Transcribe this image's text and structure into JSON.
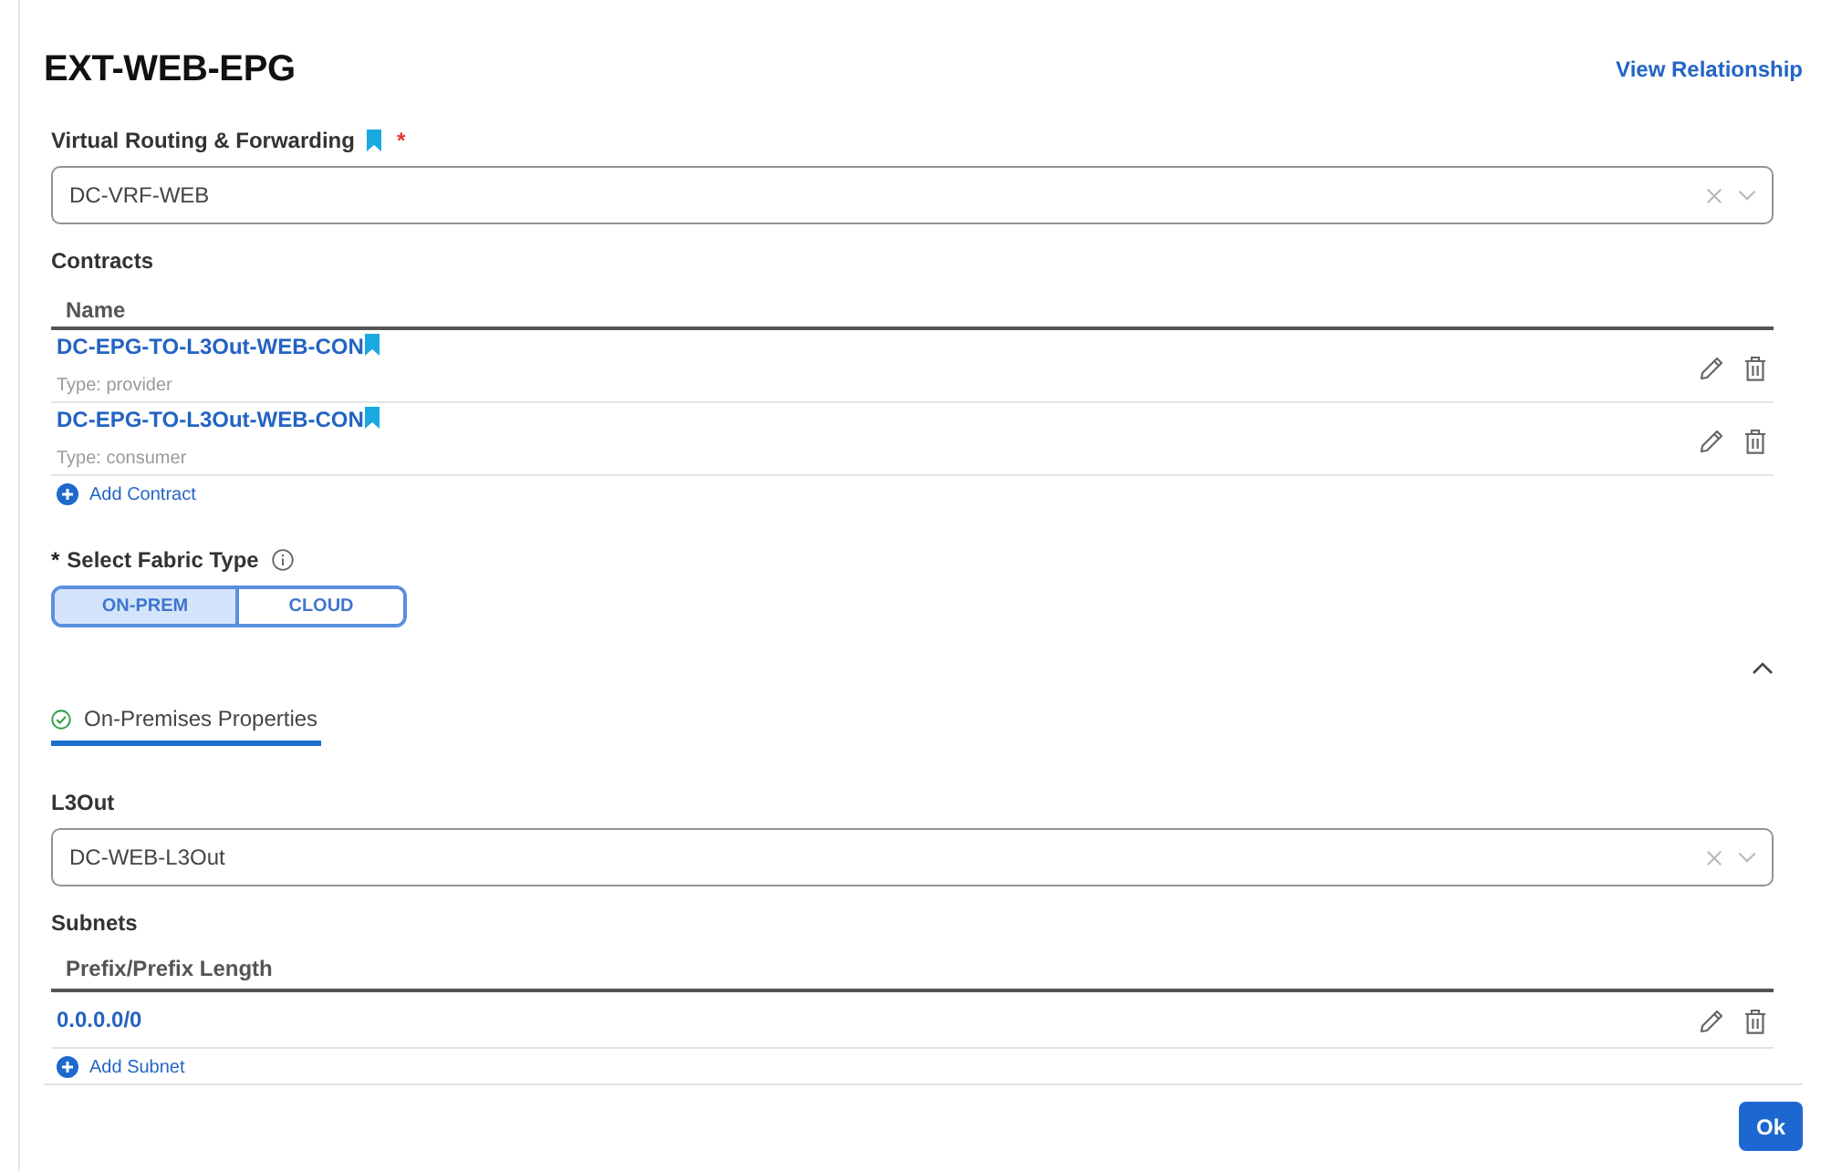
{
  "title": "EXT-WEB-EPG",
  "view_relationship_link": "View Relationship",
  "vrf": {
    "label": "Virtual Routing & Forwarding",
    "required_mark": "*",
    "value": "DC-VRF-WEB"
  },
  "contracts": {
    "label": "Contracts",
    "columns": [
      "Name"
    ],
    "rows": [
      {
        "name": "DC-EPG-TO-L3Out-WEB-CON",
        "type": "Type: provider"
      },
      {
        "name": "DC-EPG-TO-L3Out-WEB-CON",
        "type": "Type: consumer"
      }
    ],
    "add_action": "Add Contract"
  },
  "fabric_type": {
    "required_mark": "*",
    "label": "Select Fabric Type",
    "options": [
      {
        "label": "ON-PREM",
        "selected": true
      },
      {
        "label": "CLOUD",
        "selected": false
      }
    ]
  },
  "section": {
    "expanded": true,
    "tabs": [
      {
        "label": "On-Premises Properties",
        "selected": true,
        "valid": true
      }
    ]
  },
  "l3out": {
    "label": "L3Out",
    "value": "DC-WEB-L3Out"
  },
  "subnets": {
    "label": "Subnets",
    "columns": [
      "Prefix/Prefix Length"
    ],
    "rows": [
      {
        "prefix": "0.0.0.0/0"
      }
    ],
    "add_action": "Add Subnet"
  },
  "footer": {
    "buttons": [
      "Ok"
    ]
  }
}
